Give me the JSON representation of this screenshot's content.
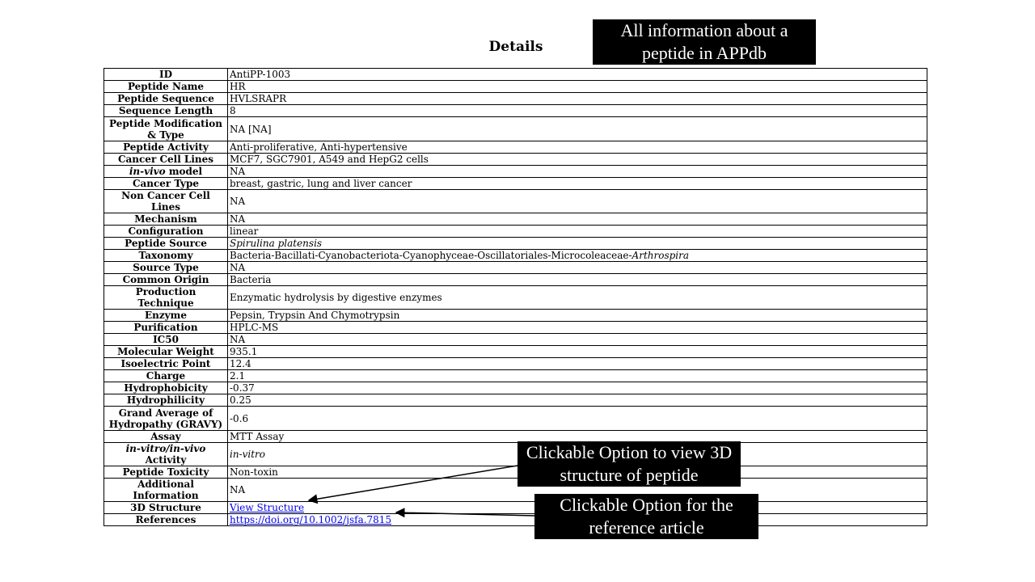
{
  "page": {
    "title": "Details"
  },
  "details": {
    "id": {
      "label": "ID",
      "value": "AntiPP-1003"
    },
    "peptide_name": {
      "label": "Peptide Name",
      "value": "HR"
    },
    "peptide_sequence": {
      "label": "Peptide Sequence",
      "value": "HVLSRAPR"
    },
    "sequence_length": {
      "label": "Sequence Length",
      "value": "8"
    },
    "modification": {
      "label": "Peptide Modification & Type",
      "value": "NA [NA]"
    },
    "peptide_activity": {
      "label": "Peptide Activity",
      "value": "Anti-proliferative, Anti-hypertensive"
    },
    "cancer_cell_lines": {
      "label": "Cancer Cell Lines",
      "value": "MCF7, SGC7901, A549 and HepG2 cells"
    },
    "in_vivo_model": {
      "label_italic": "in-vivo",
      "label_rest": " model",
      "value": "NA"
    },
    "cancer_type": {
      "label": "Cancer Type",
      "value": "breast, gastric, lung and liver cancer"
    },
    "non_cancer_cell_lines": {
      "label": "Non Cancer Cell Lines",
      "value": "NA"
    },
    "mechanism": {
      "label": "Mechanism",
      "value": "NA"
    },
    "configuration": {
      "label": "Configuration",
      "value": "linear"
    },
    "peptide_source": {
      "label": "Peptide Source",
      "value": "Spirulina platensis"
    },
    "taxonomy": {
      "label": "Taxonomy",
      "value_plain": "Bacteria-Bacillati-Cyanobacteriota-Cyanophyceae-Oscillatoriales-Microcoleaceae-",
      "value_italic": "Arthrospira"
    },
    "source_type": {
      "label": "Source Type",
      "value": "NA"
    },
    "common_origin": {
      "label": "Common Origin",
      "value": "Bacteria"
    },
    "production_technique": {
      "label": "Production Technique",
      "value": "Enzymatic hydrolysis by digestive enzymes"
    },
    "enzyme": {
      "label": "Enzyme",
      "value": "Pepsin, Trypsin And Chymotrypsin"
    },
    "purification": {
      "label": "Purification",
      "value": "HPLC-MS"
    },
    "ic50": {
      "label": "IC50",
      "value": "NA"
    },
    "molecular_weight": {
      "label": "Molecular Weight",
      "value": "935.1"
    },
    "isoelectric_point": {
      "label": "Isoelectric Point",
      "value": "12.4"
    },
    "charge": {
      "label": "Charge",
      "value": "2.1"
    },
    "hydrophobicity": {
      "label": "Hydrophobicity",
      "value": "-0.37"
    },
    "hydrophilicity": {
      "label": "Hydrophilicity",
      "value": "0.25"
    },
    "gravy": {
      "label": "Grand Average of Hydropathy (GRAVY)",
      "value": "-0.6"
    },
    "assay": {
      "label": "Assay",
      "value": "MTT Assay"
    },
    "activity": {
      "label_italic": "in-vitro/in-vivo",
      "label_rest": " Activity",
      "value": "in-vitro"
    },
    "peptide_toxicity": {
      "label": "Peptide Toxicity",
      "value": "Non-toxin"
    },
    "additional_information": {
      "label": "Additional Information",
      "value": "NA"
    },
    "structure_3d": {
      "label": "3D Structure",
      "link_text": "View Structure"
    },
    "references": {
      "label": "References",
      "link_text": "https://doi.org/10.1002/jsfa.7815"
    }
  },
  "callouts": {
    "all_info": "All information about a peptide in APPdb",
    "structure": "Clickable Option to view 3D structure of peptide",
    "reference": "Clickable Option for the reference article"
  }
}
